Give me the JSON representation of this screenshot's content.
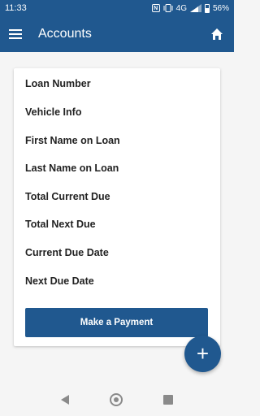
{
  "status_bar": {
    "time": "11:33",
    "nfc_label": "N",
    "network": "4G",
    "battery": "56%"
  },
  "app_bar": {
    "title": "Accounts"
  },
  "card": {
    "fields": [
      "Loan Number",
      "Vehicle Info",
      "First Name on Loan",
      "Last Name on Loan",
      "Total Current Due",
      "Total Next Due",
      "Current Due Date",
      "Next Due Date"
    ],
    "button_label": "Make a Payment"
  },
  "fab": {
    "label": "+"
  },
  "colors": {
    "primary": "#20588f",
    "background": "#f5f5f5",
    "card": "#ffffff"
  }
}
